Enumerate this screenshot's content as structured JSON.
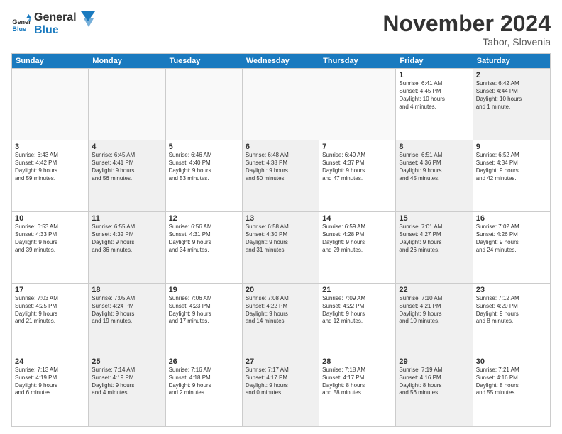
{
  "header": {
    "logo_general": "General",
    "logo_blue": "Blue",
    "month_title": "November 2024",
    "location": "Tabor, Slovenia"
  },
  "days_of_week": [
    "Sunday",
    "Monday",
    "Tuesday",
    "Wednesday",
    "Thursday",
    "Friday",
    "Saturday"
  ],
  "rows": [
    [
      {
        "day": "",
        "text": "",
        "empty": true
      },
      {
        "day": "",
        "text": "",
        "empty": true
      },
      {
        "day": "",
        "text": "",
        "empty": true
      },
      {
        "day": "",
        "text": "",
        "empty": true
      },
      {
        "day": "",
        "text": "",
        "empty": true
      },
      {
        "day": "1",
        "text": "Sunrise: 6:41 AM\nSunset: 4:45 PM\nDaylight: 10 hours\nand 4 minutes.",
        "empty": false
      },
      {
        "day": "2",
        "text": "Sunrise: 6:42 AM\nSunset: 4:44 PM\nDaylight: 10 hours\nand 1 minute.",
        "empty": false,
        "shaded": true
      }
    ],
    [
      {
        "day": "3",
        "text": "Sunrise: 6:43 AM\nSunset: 4:42 PM\nDaylight: 9 hours\nand 59 minutes.",
        "empty": false
      },
      {
        "day": "4",
        "text": "Sunrise: 6:45 AM\nSunset: 4:41 PM\nDaylight: 9 hours\nand 56 minutes.",
        "empty": false,
        "shaded": true
      },
      {
        "day": "5",
        "text": "Sunrise: 6:46 AM\nSunset: 4:40 PM\nDaylight: 9 hours\nand 53 minutes.",
        "empty": false
      },
      {
        "day": "6",
        "text": "Sunrise: 6:48 AM\nSunset: 4:38 PM\nDaylight: 9 hours\nand 50 minutes.",
        "empty": false,
        "shaded": true
      },
      {
        "day": "7",
        "text": "Sunrise: 6:49 AM\nSunset: 4:37 PM\nDaylight: 9 hours\nand 47 minutes.",
        "empty": false
      },
      {
        "day": "8",
        "text": "Sunrise: 6:51 AM\nSunset: 4:36 PM\nDaylight: 9 hours\nand 45 minutes.",
        "empty": false,
        "shaded": true
      },
      {
        "day": "9",
        "text": "Sunrise: 6:52 AM\nSunset: 4:34 PM\nDaylight: 9 hours\nand 42 minutes.",
        "empty": false
      }
    ],
    [
      {
        "day": "10",
        "text": "Sunrise: 6:53 AM\nSunset: 4:33 PM\nDaylight: 9 hours\nand 39 minutes.",
        "empty": false
      },
      {
        "day": "11",
        "text": "Sunrise: 6:55 AM\nSunset: 4:32 PM\nDaylight: 9 hours\nand 36 minutes.",
        "empty": false,
        "shaded": true
      },
      {
        "day": "12",
        "text": "Sunrise: 6:56 AM\nSunset: 4:31 PM\nDaylight: 9 hours\nand 34 minutes.",
        "empty": false
      },
      {
        "day": "13",
        "text": "Sunrise: 6:58 AM\nSunset: 4:30 PM\nDaylight: 9 hours\nand 31 minutes.",
        "empty": false,
        "shaded": true
      },
      {
        "day": "14",
        "text": "Sunrise: 6:59 AM\nSunset: 4:28 PM\nDaylight: 9 hours\nand 29 minutes.",
        "empty": false
      },
      {
        "day": "15",
        "text": "Sunrise: 7:01 AM\nSunset: 4:27 PM\nDaylight: 9 hours\nand 26 minutes.",
        "empty": false,
        "shaded": true
      },
      {
        "day": "16",
        "text": "Sunrise: 7:02 AM\nSunset: 4:26 PM\nDaylight: 9 hours\nand 24 minutes.",
        "empty": false
      }
    ],
    [
      {
        "day": "17",
        "text": "Sunrise: 7:03 AM\nSunset: 4:25 PM\nDaylight: 9 hours\nand 21 minutes.",
        "empty": false
      },
      {
        "day": "18",
        "text": "Sunrise: 7:05 AM\nSunset: 4:24 PM\nDaylight: 9 hours\nand 19 minutes.",
        "empty": false,
        "shaded": true
      },
      {
        "day": "19",
        "text": "Sunrise: 7:06 AM\nSunset: 4:23 PM\nDaylight: 9 hours\nand 17 minutes.",
        "empty": false
      },
      {
        "day": "20",
        "text": "Sunrise: 7:08 AM\nSunset: 4:22 PM\nDaylight: 9 hours\nand 14 minutes.",
        "empty": false,
        "shaded": true
      },
      {
        "day": "21",
        "text": "Sunrise: 7:09 AM\nSunset: 4:22 PM\nDaylight: 9 hours\nand 12 minutes.",
        "empty": false
      },
      {
        "day": "22",
        "text": "Sunrise: 7:10 AM\nSunset: 4:21 PM\nDaylight: 9 hours\nand 10 minutes.",
        "empty": false,
        "shaded": true
      },
      {
        "day": "23",
        "text": "Sunrise: 7:12 AM\nSunset: 4:20 PM\nDaylight: 9 hours\nand 8 minutes.",
        "empty": false
      }
    ],
    [
      {
        "day": "24",
        "text": "Sunrise: 7:13 AM\nSunset: 4:19 PM\nDaylight: 9 hours\nand 6 minutes.",
        "empty": false
      },
      {
        "day": "25",
        "text": "Sunrise: 7:14 AM\nSunset: 4:19 PM\nDaylight: 9 hours\nand 4 minutes.",
        "empty": false,
        "shaded": true
      },
      {
        "day": "26",
        "text": "Sunrise: 7:16 AM\nSunset: 4:18 PM\nDaylight: 9 hours\nand 2 minutes.",
        "empty": false
      },
      {
        "day": "27",
        "text": "Sunrise: 7:17 AM\nSunset: 4:17 PM\nDaylight: 9 hours\nand 0 minutes.",
        "empty": false,
        "shaded": true
      },
      {
        "day": "28",
        "text": "Sunrise: 7:18 AM\nSunset: 4:17 PM\nDaylight: 8 hours\nand 58 minutes.",
        "empty": false
      },
      {
        "day": "29",
        "text": "Sunrise: 7:19 AM\nSunset: 4:16 PM\nDaylight: 8 hours\nand 56 minutes.",
        "empty": false,
        "shaded": true
      },
      {
        "day": "30",
        "text": "Sunrise: 7:21 AM\nSunset: 4:16 PM\nDaylight: 8 hours\nand 55 minutes.",
        "empty": false
      }
    ]
  ]
}
